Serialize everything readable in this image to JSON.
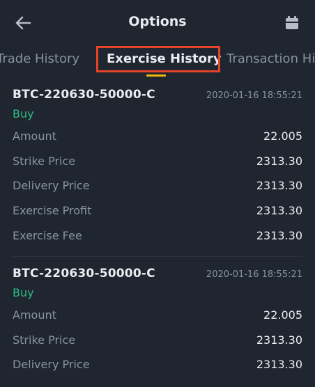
{
  "header": {
    "title": "Options",
    "back_icon": "arrow-left-icon",
    "calendar_icon": "calendar-icon"
  },
  "tabs": [
    {
      "label": "Trade History",
      "active": false
    },
    {
      "label": "Exercise History",
      "active": true
    },
    {
      "label": "Transaction Hi",
      "active": false
    }
  ],
  "colors": {
    "background": "#1f2630",
    "buy": "#2ebd85",
    "accent": "#f0b90b",
    "highlight_box": "#e64428"
  },
  "records": [
    {
      "symbol": "BTC-220630-50000-C",
      "timestamp": "2020-01-16 18:55:21",
      "side": "Buy",
      "rows": [
        {
          "label": "Amount",
          "value": "22.005"
        },
        {
          "label": "Strike Price",
          "value": "2313.30"
        },
        {
          "label": "Delivery Price",
          "value": "2313.30"
        },
        {
          "label": "Exercise Profit",
          "value": "2313.30"
        },
        {
          "label": "Exercise Fee",
          "value": "2313.30"
        }
      ]
    },
    {
      "symbol": "BTC-220630-50000-C",
      "timestamp": "2020-01-16 18:55:21",
      "side": "Buy",
      "rows": [
        {
          "label": "Amount",
          "value": "22.005"
        },
        {
          "label": "Strike Price",
          "value": "2313.30"
        },
        {
          "label": "Delivery Price",
          "value": "2313.30"
        }
      ]
    }
  ]
}
